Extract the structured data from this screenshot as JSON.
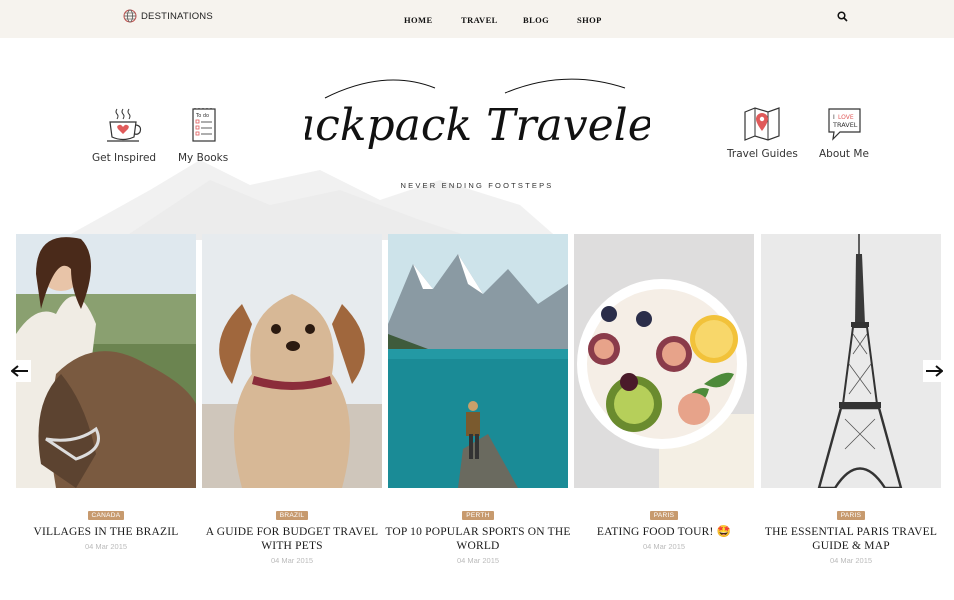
{
  "topbar": {
    "destinations_label": "DESTINATIONS",
    "nav": [
      "HOME",
      "TRAVEL",
      "BLOG",
      "SHOP"
    ]
  },
  "header": {
    "logo_text": "Backpack Travelers",
    "tagline": "NEVER ENDING FOOTSTEPS",
    "icon_links": [
      {
        "label": "Get Inspired",
        "icon": "coffee-cup-icon"
      },
      {
        "label": "My Books",
        "icon": "notebook-icon"
      },
      {
        "label": "Travel Guides",
        "icon": "map-pin-icon"
      },
      {
        "label": "About Me",
        "icon": "speech-bubble-icon"
      }
    ]
  },
  "posts": [
    {
      "tag": "CANADA",
      "title": "VILLAGES IN THE BRAZIL",
      "date": "04 Mar 2015",
      "image": "girl-with-donkey"
    },
    {
      "tag": "BRAZIL",
      "title": "A GUIDE FOR BUDGET TRAVEL WITH PETS",
      "date": "04 Mar 2015",
      "image": "spaniel-dog"
    },
    {
      "tag": "PERTH",
      "title": "TOP 10 POPULAR SPORTS ON THE WORLD",
      "date": "04 Mar 2015",
      "image": "mountain-lake"
    },
    {
      "tag": "PARIS",
      "title": "EATING FOOD TOUR! 🤩",
      "date": "04 Mar 2015",
      "image": "fruit-bowl"
    },
    {
      "tag": "PARIS",
      "title": "THE ESSENTIAL PARIS TRAVEL GUIDE & MAP",
      "date": "04 Mar 2015",
      "image": "eiffel-tower"
    }
  ],
  "colors": {
    "accent": "#c79a6e",
    "topbar_bg": "#f6f3ee",
    "heart": "#e05a5a"
  }
}
